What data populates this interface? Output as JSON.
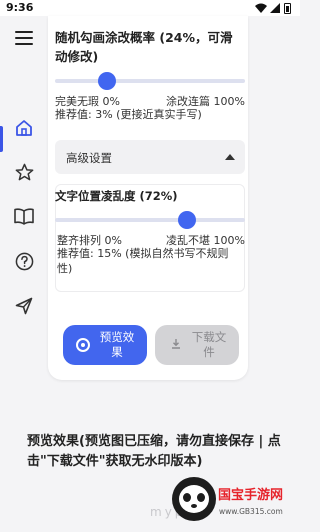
{
  "status_bar": {
    "time": "9:36"
  },
  "nav": {
    "icons": [
      "menu-icon",
      "home-icon",
      "star-icon",
      "book-icon",
      "help-icon",
      "send-icon"
    ],
    "active": "home-icon"
  },
  "settings": {
    "probability": {
      "title": "随机勾画涂改概率 (24%，可滑动修改)",
      "value_percent": 24,
      "min_label": "完美无瑕 0%",
      "max_label": "涂改连篇 100%",
      "hint": "推荐值: 3% (更接近真实手写)"
    },
    "advanced": {
      "label": "高级设置",
      "expanded": true
    },
    "disorder": {
      "title": "文字位置凌乱度 (72%)",
      "value_percent": 72,
      "min_label": "整齐排列 0%",
      "max_label": "凌乱不堪 100%",
      "hint": "推荐值: 15% (模拟自然书写不规则性)"
    }
  },
  "actions": {
    "preview_label": "预览效果",
    "download_label": "下载文件",
    "download_enabled": false
  },
  "footer": {
    "text": "预览效果(预览图已压缩，请勿直接保存 | 点击\"下载文件\"获取无水印版本)",
    "watermark": "mypa"
  },
  "logo": {
    "name": "国宝手游网",
    "site": "www.GB315.com"
  },
  "colors": {
    "accent": "#4166f0",
    "track": "#dde0ef",
    "disabled": "#d3d3d6",
    "logo_red": "#e6232b"
  }
}
